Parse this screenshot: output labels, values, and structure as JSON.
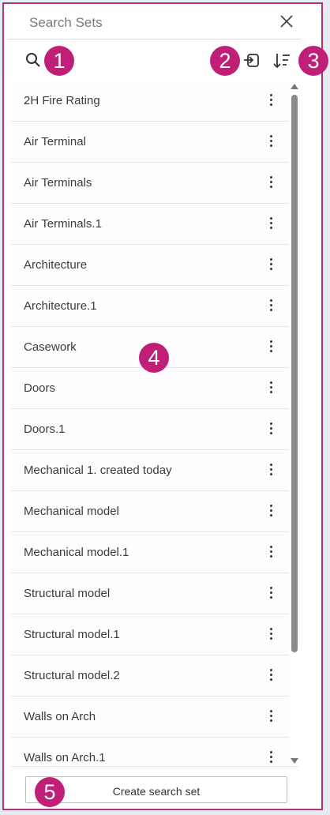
{
  "header": {
    "title": "Search Sets"
  },
  "badges": [
    "1",
    "2",
    "3",
    "4",
    "5"
  ],
  "list": {
    "items": [
      "2H Fire Rating",
      "Air Terminal",
      "Air Terminals",
      "Air Terminals.1",
      "Architecture",
      "Architecture.1",
      "Casework",
      "Doors",
      "Doors.1",
      "Mechanical 1. created today",
      "Mechanical model",
      "Mechanical model.1",
      "Structural model",
      "Structural model.1",
      "Structural model.2",
      "Walls on Arch",
      "Walls on Arch.1"
    ]
  },
  "footer": {
    "create_label": "Create search set"
  },
  "colors": {
    "accent": "#c01f78",
    "border": "#b8307a"
  },
  "icons": [
    "search-icon",
    "close-icon",
    "import-search-set-icon",
    "sort-icon",
    "more-options-icon"
  ]
}
